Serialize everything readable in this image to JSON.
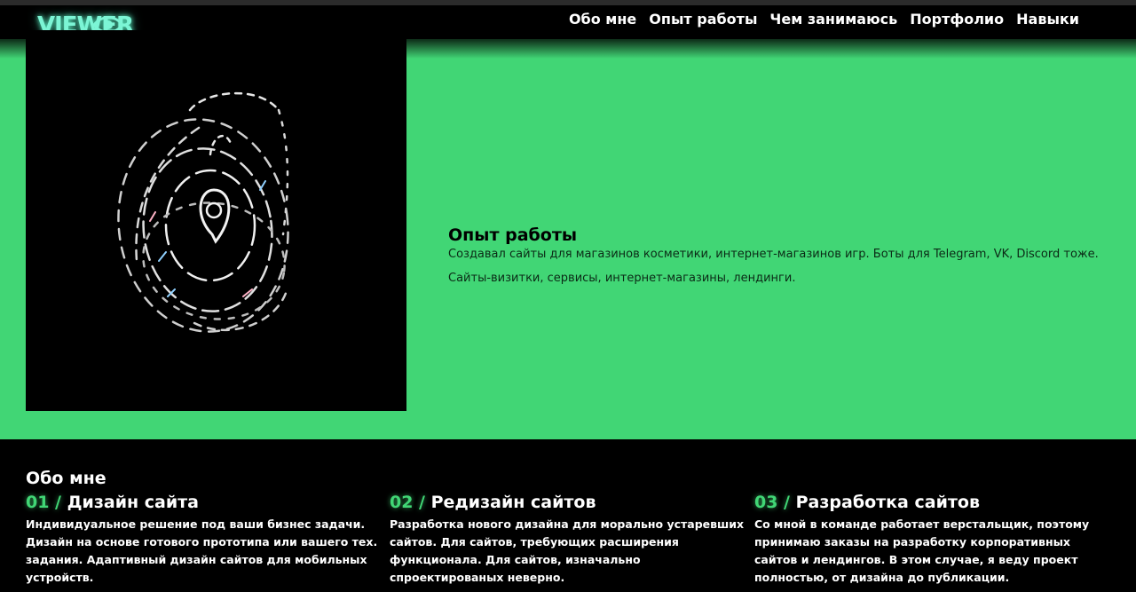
{
  "header": {
    "logo_text": "VIEWER",
    "nav": [
      "Обо мне",
      "Опыт работы",
      "Чем занимаюсь",
      "Портфолио",
      "Навыки"
    ]
  },
  "hero": {
    "image_icon": "location-pin-spiral-icon",
    "title": "Опыт работы",
    "text1": "Создавал сайты для магазинов косметики, интернет-магазинов игр. Боты для Telegram, VK, Discord тоже.",
    "text2": "Сайты-визитки, сервисы, интернет-магазины, лендинги."
  },
  "about": {
    "title": "Обо мне",
    "cards": [
      {
        "num": "01 /",
        "title": "Дизайн сайта",
        "text": "Индивидуальное решение под ваши бизнес задачи. Дизайн на основе готового прототипа или вашего тех. задания. Адаптивный дизайн сайтов для мобильных устройств."
      },
      {
        "num": "02 /",
        "title": "Редизайн сайтов",
        "text": "Разработка нового дизайна для морально устаревших сайтов. Для сайтов, требующих расширения функционала. Для сайтов, изначально спроектированых неверно."
      },
      {
        "num": "03 /",
        "title": "Разработка сайтов",
        "text": "Со мной в команде работает верстальщик, поэтому принимаю заказы на разработку корпоративных сайтов и лендингов. В этом случае, я веду проект полностью, от дизайна до публикации."
      }
    ]
  },
  "colors": {
    "accent_green": "#41d675",
    "logo_mint": "#7cf5d5",
    "background": "#000000"
  }
}
